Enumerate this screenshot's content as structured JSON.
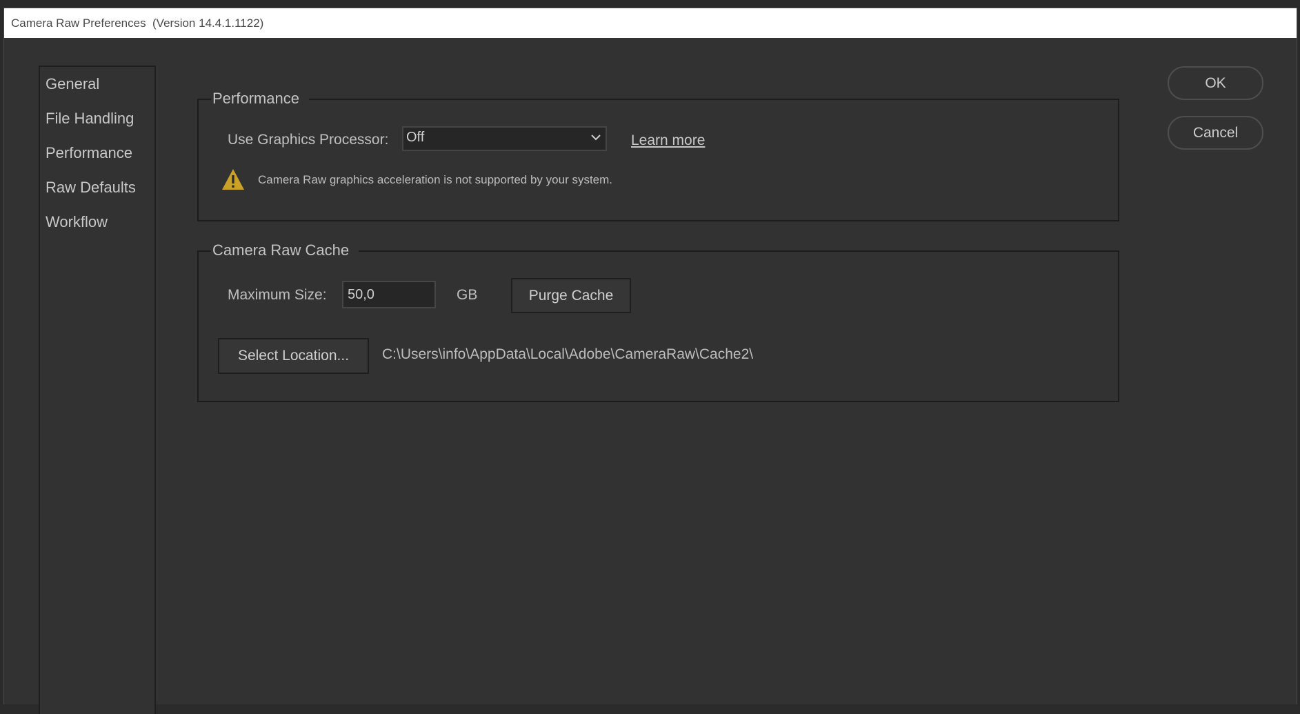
{
  "window": {
    "title": "Camera Raw Preferences  (Version 14.4.1.1122)"
  },
  "sidebar": {
    "items": [
      {
        "label": "General"
      },
      {
        "label": "File Handling"
      },
      {
        "label": "Performance"
      },
      {
        "label": "Raw Defaults"
      },
      {
        "label": "Workflow"
      }
    ]
  },
  "performance": {
    "legend": "Performance",
    "gpu_label": "Use Graphics Processor:",
    "gpu_value": "Off",
    "learn_more": "Learn more",
    "warning_icon": "warning-triangle-icon",
    "warning_text": "Camera Raw graphics acceleration is not supported by your system."
  },
  "cache": {
    "legend": "Camera Raw Cache",
    "max_size_label": "Maximum Size:",
    "max_size_value": "50,0",
    "unit": "GB",
    "purge_label": "Purge Cache",
    "select_location_label": "Select Location...",
    "path": "C:\\Users\\info\\AppData\\Local\\Adobe\\CameraRaw\\Cache2\\"
  },
  "buttons": {
    "ok": "OK",
    "cancel": "Cancel"
  },
  "colors": {
    "background": "#323232",
    "title_bar": "#ffffff",
    "warning": "#c9a227"
  }
}
